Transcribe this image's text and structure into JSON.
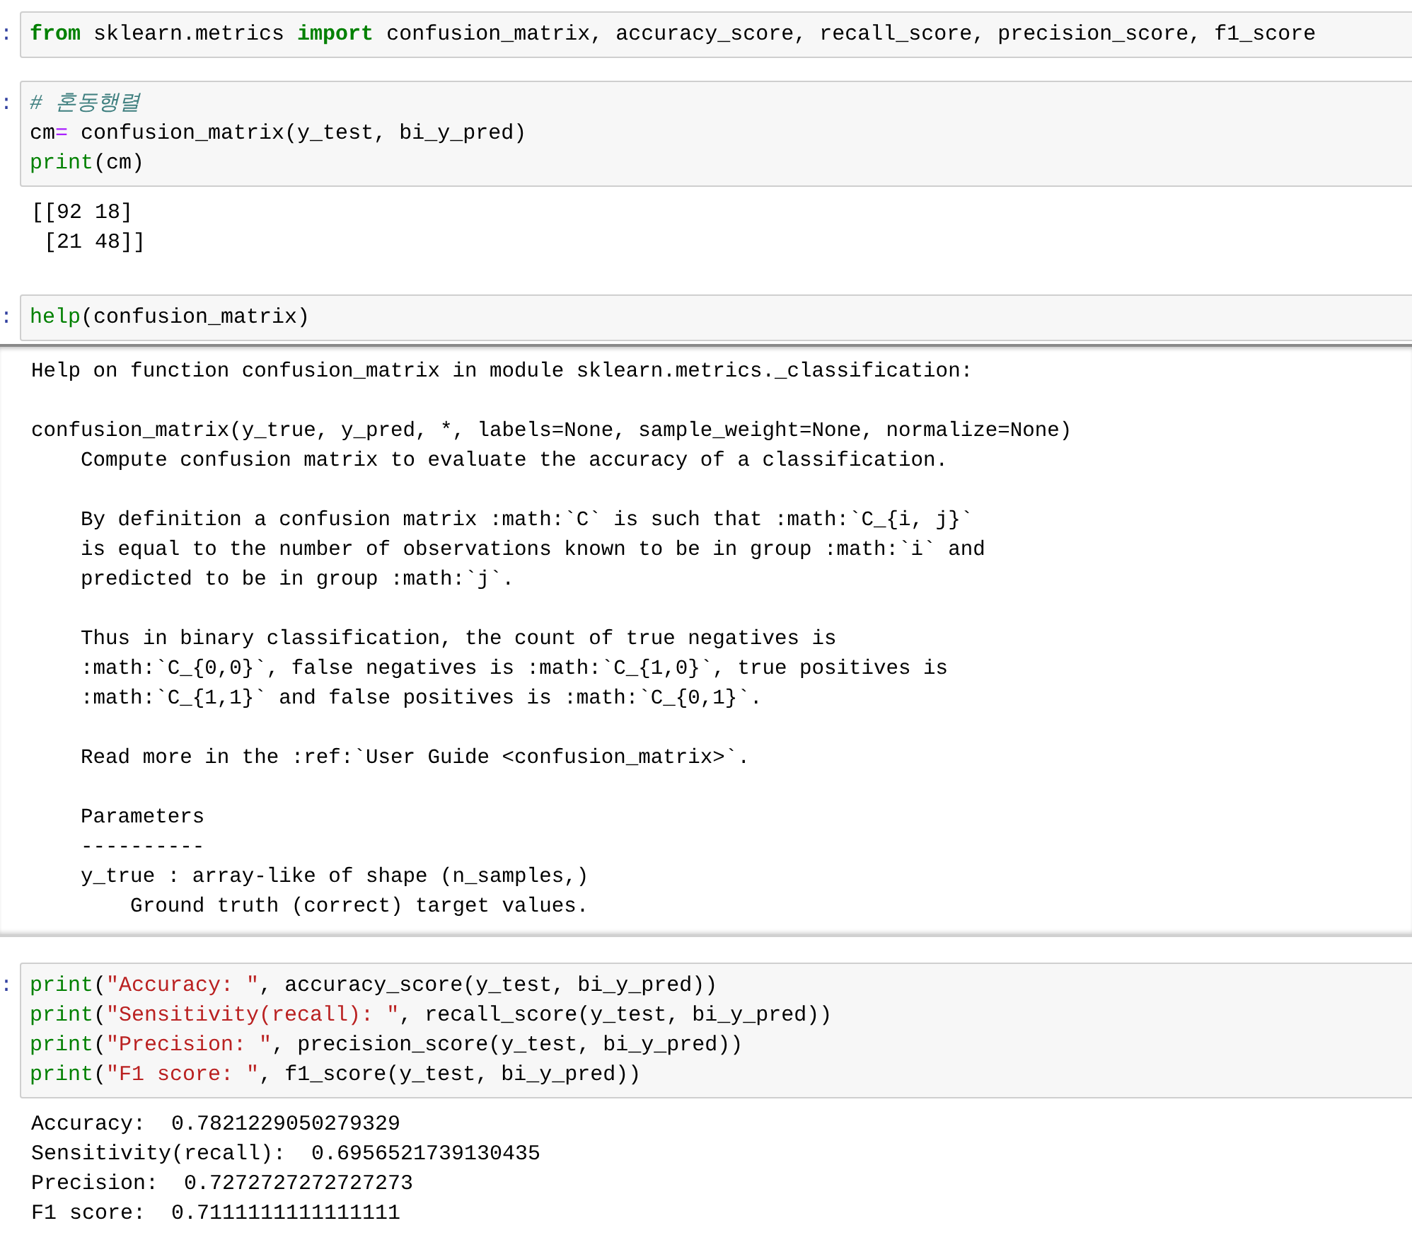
{
  "cells": [
    {
      "prompt": ":",
      "code": [
        [
          {
            "kind": "keyword",
            "text": "from"
          },
          {
            "kind": "plain",
            "text": " sklearn.metrics "
          },
          {
            "kind": "keyword",
            "text": "import"
          },
          {
            "kind": "plain",
            "text": " confusion_matrix, accuracy_score, recall_score, precision_score, f1_score"
          }
        ]
      ]
    },
    {
      "prompt": ":",
      "code": [
        [
          {
            "kind": "comment",
            "text": "# 혼동행렬"
          }
        ],
        [
          {
            "kind": "plain",
            "text": "cm"
          },
          {
            "kind": "operator",
            "text": "="
          },
          {
            "kind": "plain",
            "text": " confusion_matrix(y_test, bi_y_pred)"
          }
        ],
        [
          {
            "kind": "builtin",
            "text": "print"
          },
          {
            "kind": "plain",
            "text": "(cm)"
          }
        ]
      ],
      "output": {
        "kind": "stream",
        "paragraphs": [
          [
            "[[92 18]",
            " [21 48]]"
          ]
        ]
      }
    },
    {
      "prompt": ":",
      "code": [
        [
          {
            "kind": "builtin",
            "text": "help"
          },
          {
            "kind": "plain",
            "text": "(confusion_matrix)"
          }
        ]
      ],
      "output": {
        "kind": "pager",
        "paragraphs": [
          [
            "Help on function confusion_matrix in module sklearn.metrics._classification:"
          ],
          [
            "confusion_matrix(y_true, y_pred, *, labels=None, sample_weight=None, normalize=None)",
            "    Compute confusion matrix to evaluate the accuracy of a classification."
          ],
          [
            "    By definition a confusion matrix :math:`C` is such that :math:`C_{i, j}`",
            "    is equal to the number of observations known to be in group :math:`i` and",
            "    predicted to be in group :math:`j`."
          ],
          [
            "    Thus in binary classification, the count of true negatives is",
            "    :math:`C_{0,0}`, false negatives is :math:`C_{1,0}`, true positives is",
            "    :math:`C_{1,1}` and false positives is :math:`C_{0,1}`."
          ],
          [
            "    Read more in the :ref:`User Guide <confusion_matrix>`."
          ],
          [
            "    Parameters",
            "    ----------",
            "    y_true : array-like of shape (n_samples,)",
            "        Ground truth (correct) target values."
          ]
        ]
      }
    },
    {
      "prompt": ":",
      "code": [
        [
          {
            "kind": "builtin",
            "text": "print"
          },
          {
            "kind": "plain",
            "text": "("
          },
          {
            "kind": "string",
            "text": "\"Accuracy: \""
          },
          {
            "kind": "plain",
            "text": ", accuracy_score(y_test, bi_y_pred))"
          }
        ],
        [
          {
            "kind": "builtin",
            "text": "print"
          },
          {
            "kind": "plain",
            "text": "("
          },
          {
            "kind": "string",
            "text": "\"Sensitivity(recall): \""
          },
          {
            "kind": "plain",
            "text": ", recall_score(y_test, bi_y_pred))"
          }
        ],
        [
          {
            "kind": "builtin",
            "text": "print"
          },
          {
            "kind": "plain",
            "text": "("
          },
          {
            "kind": "string",
            "text": "\"Precision: \""
          },
          {
            "kind": "plain",
            "text": ", precision_score(y_test, bi_y_pred))"
          }
        ],
        [
          {
            "kind": "builtin",
            "text": "print"
          },
          {
            "kind": "plain",
            "text": "("
          },
          {
            "kind": "string",
            "text": "\"F1 score: \""
          },
          {
            "kind": "plain",
            "text": ", f1_score(y_test, bi_y_pred))"
          }
        ]
      ],
      "output": {
        "kind": "stream",
        "paragraphs": [
          [
            "Accuracy:  0.7821229050279329",
            "Sensitivity(recall):  0.6956521739130435",
            "Precision:  0.7272727272727273",
            "F1 score:  0.7111111111111111"
          ]
        ]
      }
    }
  ]
}
